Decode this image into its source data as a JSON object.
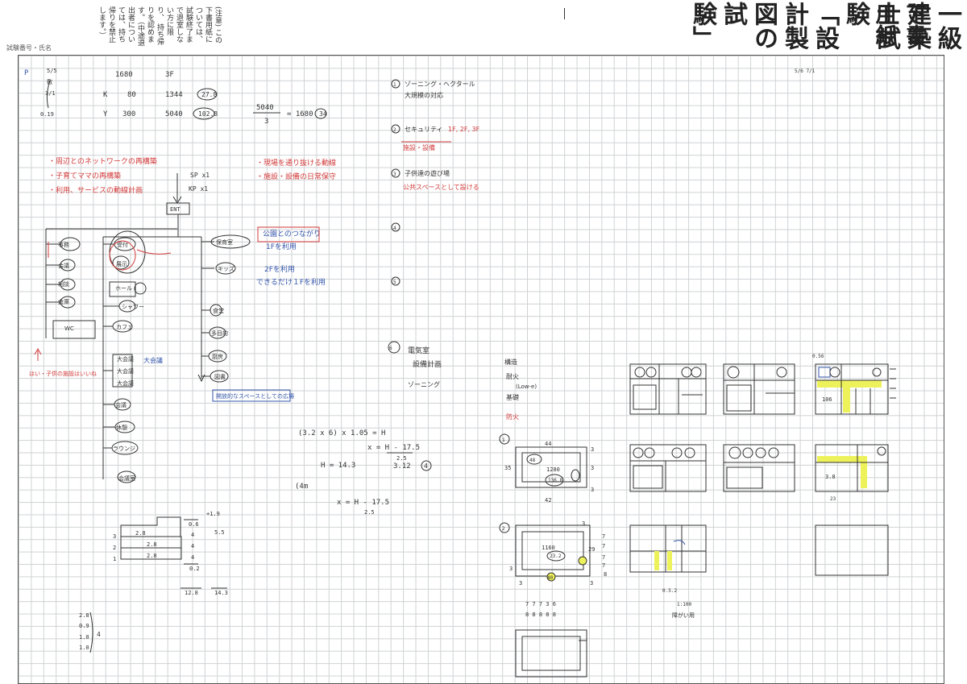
{
  "header": {
    "title_chars": [
      "一級建築士試験「設計製図の試験」",
      "下書用紙"
    ],
    "notes_label": "(注意)",
    "notes": [
      "この下書用紙については、試験終了まで退室しない方に限り、",
      "持ち帰りを認めます。（中途退出者については、持ち帰りを禁止します。）"
    ],
    "corner_text": "試験番号・氏名"
  },
  "sketch": {
    "calc": {
      "p": "P",
      "row1": [
        "1680",
        "3F"
      ],
      "row2": [
        "K",
        "80",
        "1344",
        "27.8"
      ],
      "row3": [
        "Y",
        "300",
        "5040",
        "102.8"
      ],
      "fraction_num": "5040",
      "fraction_den": "3",
      "fraction_res": "= 1680",
      "fraction_circ": "34",
      "side": [
        "5/5",
        "敷",
        "3/1",
        "0.19"
      ]
    },
    "red_notes_left": [
      "・周辺とのネットワークの再構築",
      "・子育てママの再構築",
      "・利用、サービスの動線計画"
    ],
    "red_notes_mid": [
      "・現場を通り抜ける動線",
      "・施設・設備の日常保守",
      ""
    ],
    "labels_mid": [
      "SP x1",
      "KP x1"
    ],
    "ent": "ENT",
    "rooms_left": [
      "事務",
      "会議",
      "相談",
      "倉庫",
      "WC"
    ],
    "rooms_center": [
      "受付",
      "展示",
      "ホール",
      "シャワー",
      "カフェ",
      "大会議",
      "大会議",
      "大会議",
      "会議",
      "休憩",
      "ラウンジ",
      "会議室"
    ],
    "rooms_right": [
      "保育室",
      "キッズ",
      "食堂",
      "多目的",
      "厨房",
      "図書"
    ],
    "blue_notes": [
      "公園とのつながり",
      "1Fを利用",
      "2Fを利用",
      "できるだけ１Fを利用"
    ],
    "blue_box_bottom": "開放的なスペースとしての広場",
    "red_bottom_left": "はい・子供の施設はいいね",
    "right_list": [
      "ゾーニング・ヘクタール",
      "大規模の対応",
      "セキュリティ",
      "施設・設備",
      "子供達の遊び場",
      "公共スペースとして設ける"
    ],
    "right_list_red": [
      "ゾーニング",
      "1F, 2F, 3F"
    ],
    "circ_nums": [
      "1",
      "2",
      "3",
      "4",
      "5",
      "6"
    ],
    "mep_note": [
      "電気室",
      "設備計画"
    ],
    "mep_sub": "ゾーニング",
    "formula": {
      "l1": "(3.2 x 6) x 1.05 = H",
      "l2": "x = H - 17.5",
      "l2d": "2.5",
      "l3": "H = 14.3",
      "l3r": "3.12",
      "l3c": "4",
      "l4": "(4m",
      "l5": "x = H - 17.5",
      "l5d": "2.5"
    },
    "section": {
      "rows": [
        "3",
        "2",
        "1"
      ],
      "vals": [
        "2.8",
        "2.8",
        "2.8"
      ],
      "right": [
        "0.6",
        "4",
        "4",
        "4",
        "0.2"
      ],
      "plus": "+1.9",
      "tot": "5.5",
      "sum1": "12.8",
      "sum2": "14.3"
    },
    "bottom_calc": [
      "2.8",
      "0.9",
      "1.0",
      "1.0"
    ],
    "bottom_calc_res": "4",
    "plan1": {
      "num": "1",
      "top": "44",
      "left": "35",
      "bottom": "42",
      "right": [
        "3",
        "3",
        "3"
      ],
      "inner": [
        "1280",
        "48",
        "136.8"
      ]
    },
    "plan2": {
      "num": "2",
      "inner": [
        "1160",
        "23.2"
      ],
      "right": [
        "7",
        "7",
        "29",
        "7",
        "7",
        "8"
      ],
      "bottom": "40",
      "corners": [
        "3",
        "3",
        "3",
        "3"
      ]
    },
    "under_plan2": [
      "7 7 7 3 6",
      "8 8 8 8 8"
    ],
    "vertical_text": [
      "構造",
      "耐火",
      "基礎",
      "防火"
    ],
    "vertical_sub": "(Low-e)",
    "thumb_labels": [
      "0.56",
      "106",
      "3.8",
      "23",
      "0.5.2",
      "1:100",
      "障がい用"
    ],
    "topright": "5/6\n7/1"
  }
}
